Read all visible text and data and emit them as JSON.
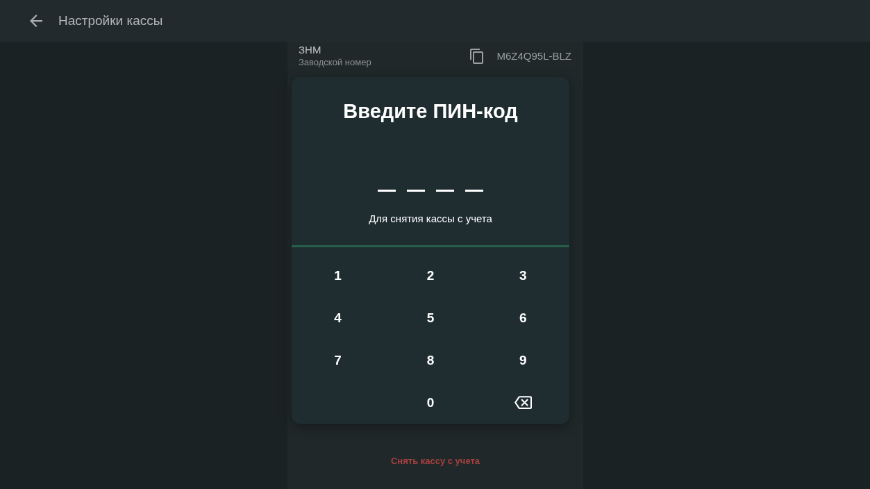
{
  "header": {
    "title": "Настройки кассы"
  },
  "serial": {
    "label": "ЗНМ",
    "caption": "Заводской номер",
    "value": "M6Z4Q95L-BLZ"
  },
  "pin_dialog": {
    "title": "Введите ПИН-код",
    "slots": [
      {
        "filled": false
      },
      {
        "filled": false
      },
      {
        "filled": false
      },
      {
        "filled": false
      }
    ],
    "hint": "Для снятия кассы с учета",
    "keys": [
      {
        "kind": "digit",
        "label": "1"
      },
      {
        "kind": "digit",
        "label": "2"
      },
      {
        "kind": "digit",
        "label": "3"
      },
      {
        "kind": "digit",
        "label": "4"
      },
      {
        "kind": "digit",
        "label": "5"
      },
      {
        "kind": "digit",
        "label": "6"
      },
      {
        "kind": "digit",
        "label": "7"
      },
      {
        "kind": "digit",
        "label": "8"
      },
      {
        "kind": "digit",
        "label": "9"
      },
      {
        "kind": "blank"
      },
      {
        "kind": "digit",
        "label": "0"
      },
      {
        "kind": "backspace"
      }
    ]
  },
  "deregister_button": {
    "label": "Снять кассу с учета"
  }
}
